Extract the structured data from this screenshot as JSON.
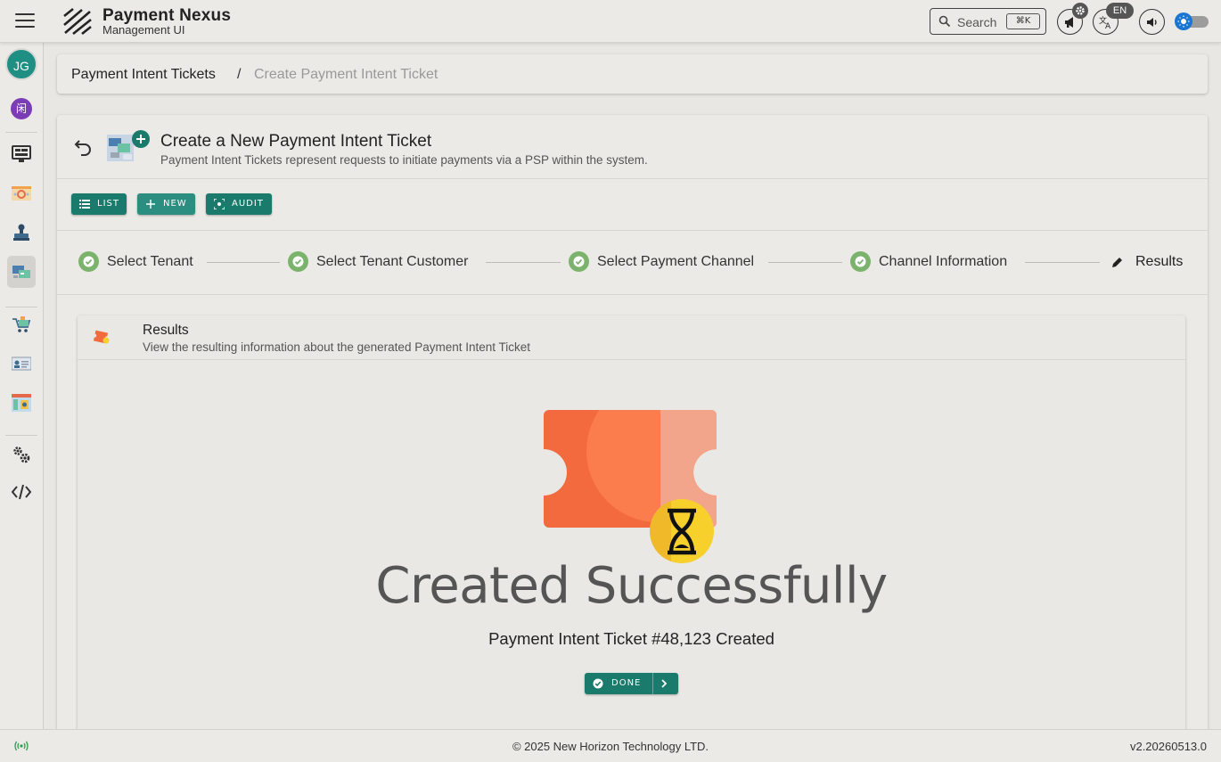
{
  "app": {
    "brand_title": "Payment Nexus",
    "brand_subtitle": "Management UI"
  },
  "topbar": {
    "search_label": "Search",
    "search_shortcut": "⌘K",
    "language_badge": "EN",
    "icons": [
      "menu-icon",
      "search-icon",
      "announcement-icon",
      "settings-badge-icon",
      "translate-icon",
      "volume-icon",
      "sun-icon"
    ]
  },
  "sidebar": {
    "avatar_initials": "JG",
    "tenant_badge": "闲",
    "items": [
      {
        "name": "dashboard",
        "icon": "monitor-icon"
      },
      {
        "name": "gateways",
        "icon": "banner-icon"
      },
      {
        "name": "cashier",
        "icon": "stamp-icon"
      },
      {
        "name": "payment-intent-tickets",
        "icon": "payment-ticket-icon",
        "active": true
      },
      {
        "name": "merchants",
        "icon": "cart-icon"
      },
      {
        "name": "customers",
        "icon": "id-card-icon"
      },
      {
        "name": "reports",
        "icon": "report-icon"
      },
      {
        "name": "settings",
        "icon": "gears-icon"
      },
      {
        "name": "developer",
        "icon": "code-icon"
      }
    ]
  },
  "breadcrumb": {
    "parent": "Payment Intent Tickets",
    "separator": "/",
    "current": "Create Payment Intent Ticket"
  },
  "page": {
    "title": "Create a New Payment Intent Ticket",
    "subtitle": "Payment Intent Tickets represent requests to initiate payments via a PSP within the system."
  },
  "actions": {
    "list": "LIST",
    "new": "NEW",
    "audit": "AUDIT"
  },
  "stepper": {
    "steps": [
      {
        "label": "Select Tenant",
        "status": "complete"
      },
      {
        "label": "Select Tenant Customer",
        "status": "complete"
      },
      {
        "label": "Select Payment Channel",
        "status": "complete"
      },
      {
        "label": "Channel Information",
        "status": "complete"
      },
      {
        "label": "Results",
        "status": "active"
      }
    ]
  },
  "results": {
    "title": "Results",
    "subtitle": "View the resulting information about the generated Payment Intent Ticket",
    "headline": "Created Successfully",
    "message": "Payment Intent Ticket #48,123 Created",
    "done_label": "DONE"
  },
  "footer": {
    "copyright": "© 2025 New Horizon Technology LTD.",
    "version": "v2.20260513.0"
  },
  "colors": {
    "accent": "#1a7a6c",
    "step_complete": "#7bb36d",
    "ticket_primary": "#f26a3d",
    "ticket_light": "#f3a58b",
    "hourglass": "#f7d02c"
  }
}
